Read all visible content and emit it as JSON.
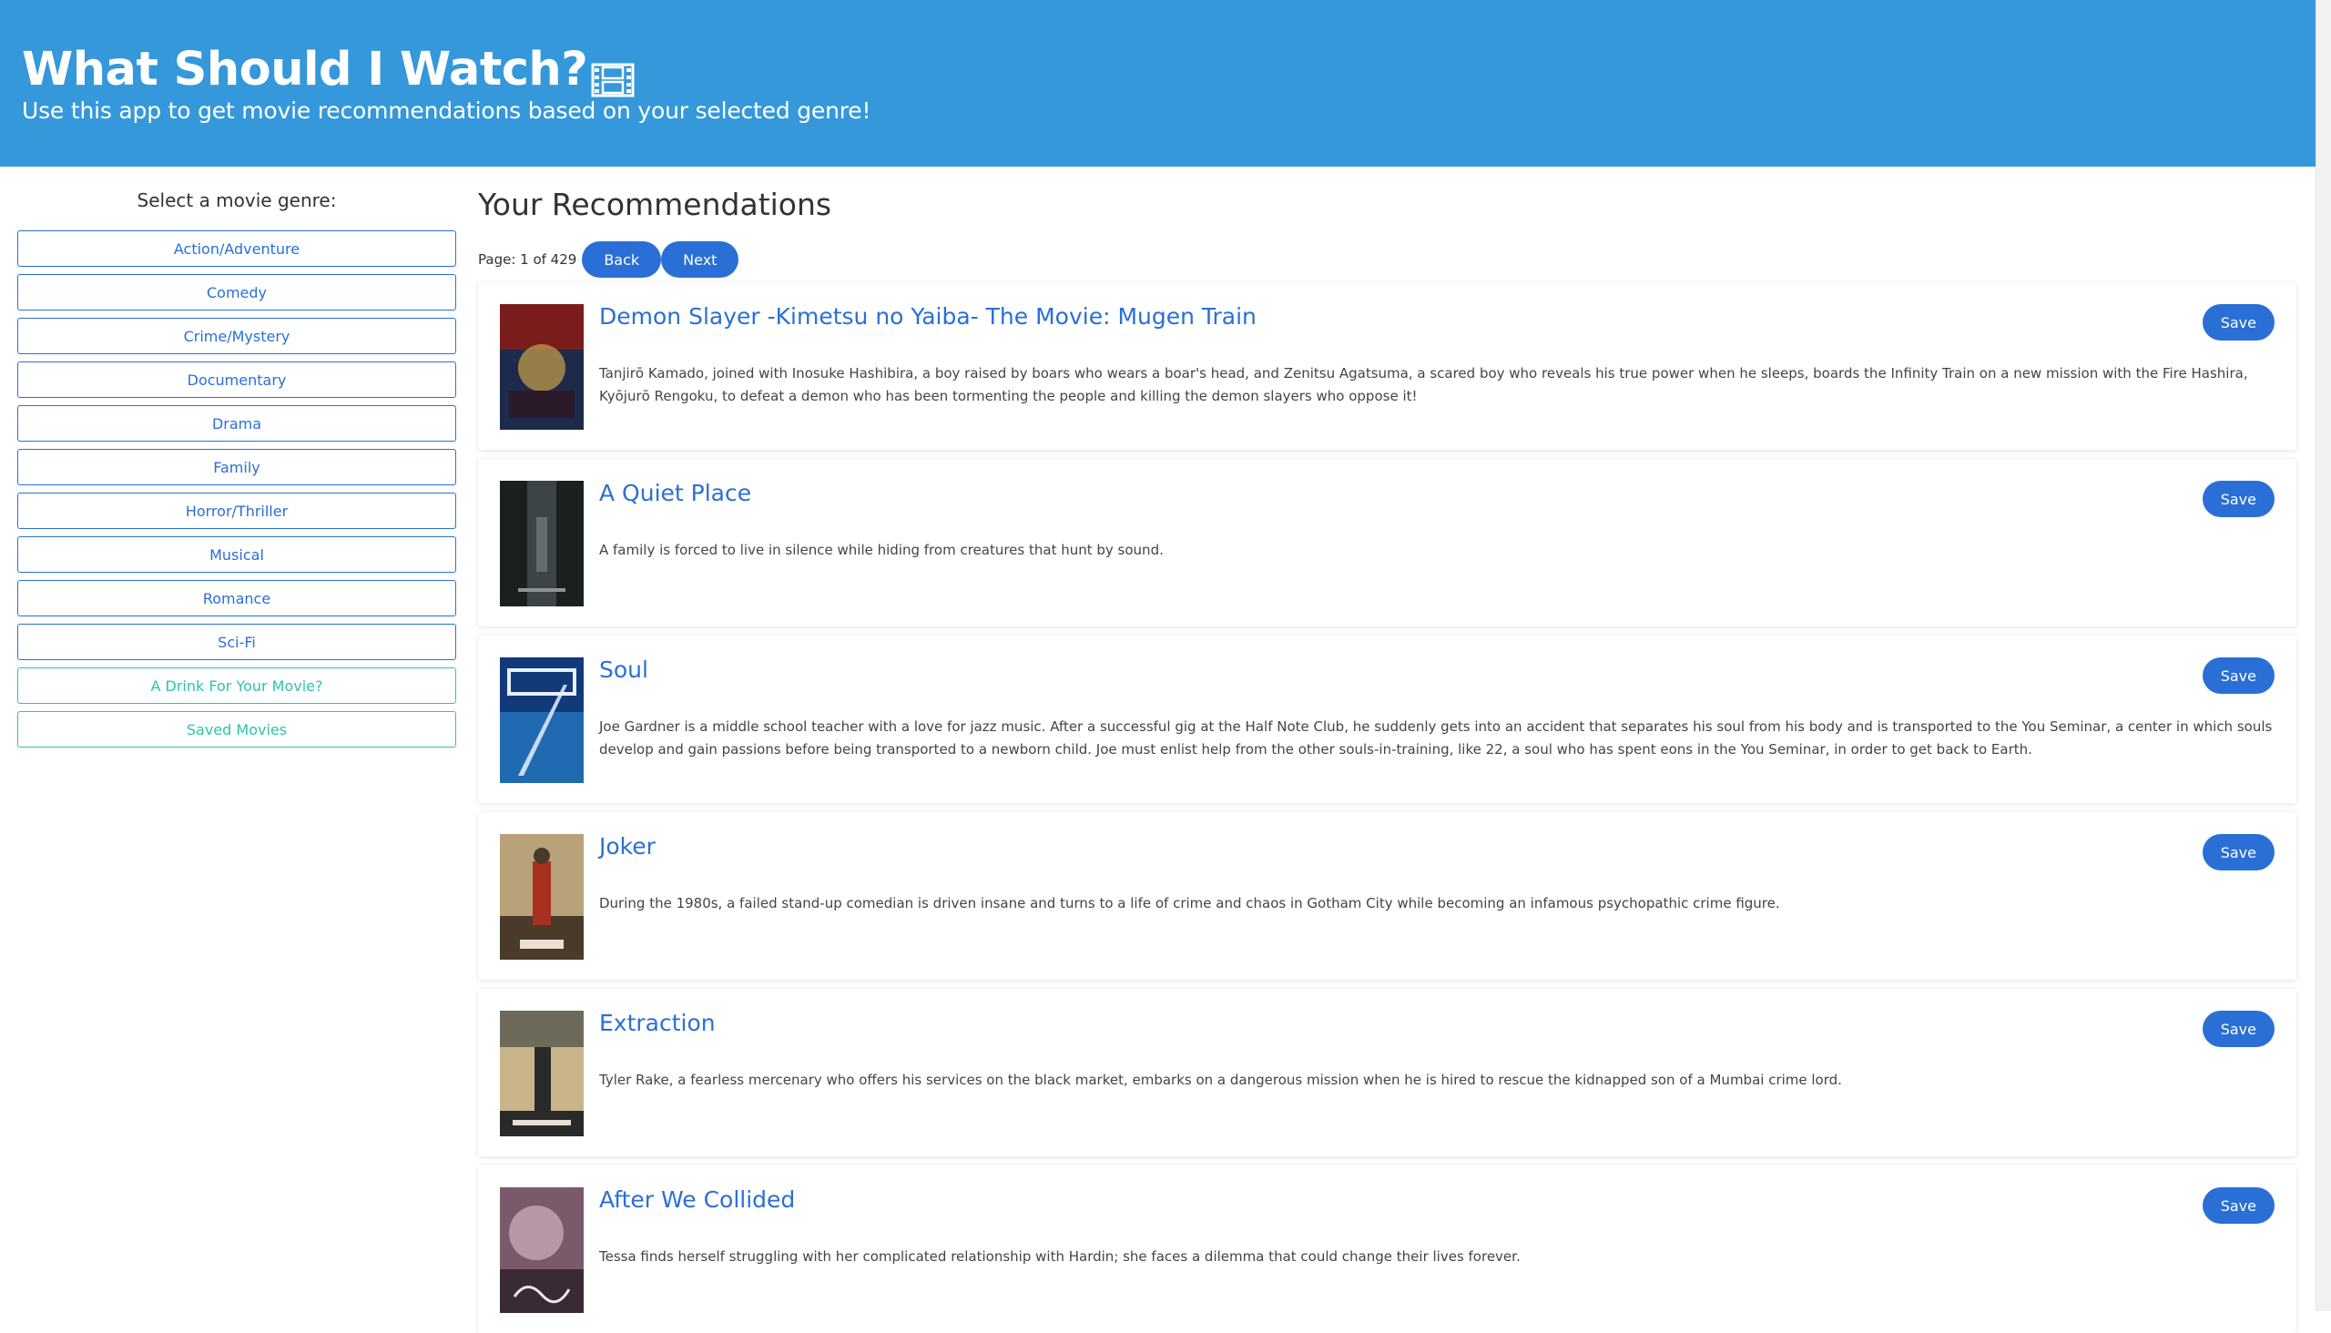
{
  "header": {
    "title": "What Should I Watch?",
    "title_icon": "film-frames-icon",
    "subtitle": "Use this app to get movie recommendations based on your selected genre!",
    "background": "#3498db"
  },
  "sidebar": {
    "prompt": "Select a movie genre:",
    "genres": [
      {
        "label": "Action/Adventure"
      },
      {
        "label": "Comedy"
      },
      {
        "label": "Crime/Mystery"
      },
      {
        "label": "Documentary"
      },
      {
        "label": "Drama"
      },
      {
        "label": "Family"
      },
      {
        "label": "Horror/Thriller"
      },
      {
        "label": "Musical"
      },
      {
        "label": "Romance"
      },
      {
        "label": "Sci-Fi"
      }
    ],
    "extras": [
      {
        "label": "A Drink For Your Movie?"
      },
      {
        "label": "Saved Movies"
      }
    ],
    "colors": {
      "genre": "#2a6fd6",
      "extra": "#2ec4a8"
    }
  },
  "main": {
    "heading": "Your Recommendations",
    "page_text": "Page: 1 of 429",
    "back_label": "Back",
    "next_label": "Next",
    "save_label": "Save",
    "accent": "#2a6fd6",
    "movies": [
      {
        "title": "Demon Slayer -Kimetsu no Yaiba- The Movie: Mugen Train",
        "overview": "Tanjirō Kamado, joined with Inosuke Hashibira, a boy raised by boars who wears a boar's head, and Zenitsu Agatsuma, a scared boy who reveals his true power when he sleeps, boards the Infinity Train on a new mission with the Fire Hashira, Kyōjurō Rengoku, to defeat a demon who has been tormenting the people and killing the demon slayers who oppose it!",
        "poster_colors": [
          "#7a1c1c",
          "#1e2a4a",
          "#c9a24a"
        ]
      },
      {
        "title": "A Quiet Place",
        "overview": "A family is forced to live in silence while hiding from creatures that hunt by sound.",
        "poster_colors": [
          "#1b1f20",
          "#3d4446",
          "#8e9496"
        ]
      },
      {
        "title": "Soul",
        "overview": "Joe Gardner is a middle school teacher with a love for jazz music. After a successful gig at the Half Note Club, he suddenly gets into an accident that separates his soul from his body and is transported to the You Seminar, a center in which souls develop and gain passions before being transported to a newborn child. Joe must enlist help from the other souls-in-training, like 22, a soul who has spent eons in the You Seminar, in order to get back to Earth.",
        "poster_colors": [
          "#123a7a",
          "#2a8ad6",
          "#e8f0ff"
        ]
      },
      {
        "title": "Joker",
        "overview": "During the 1980s, a failed stand-up comedian is driven insane and turns to a life of crime and chaos in Gotham City while becoming an infamous psychopathic crime figure.",
        "poster_colors": [
          "#b9a27a",
          "#a8301f",
          "#4a3a2a"
        ]
      },
      {
        "title": "Extraction",
        "overview": "Tyler Rake, a fearless mercenary who offers his services on the black market, embarks on a dangerous mission when he is hired to rescue the kidnapped son of a Mumbai crime lord.",
        "poster_colors": [
          "#c9b48a",
          "#6d6a5a",
          "#2a2a2a"
        ]
      },
      {
        "title": "After We Collided",
        "overview": "Tessa finds herself struggling with her complicated relationship with Hardin; she faces a dilemma that could change their lives forever.",
        "poster_colors": [
          "#7a5a6a",
          "#c7a6b4",
          "#3a2a34"
        ]
      }
    ]
  }
}
